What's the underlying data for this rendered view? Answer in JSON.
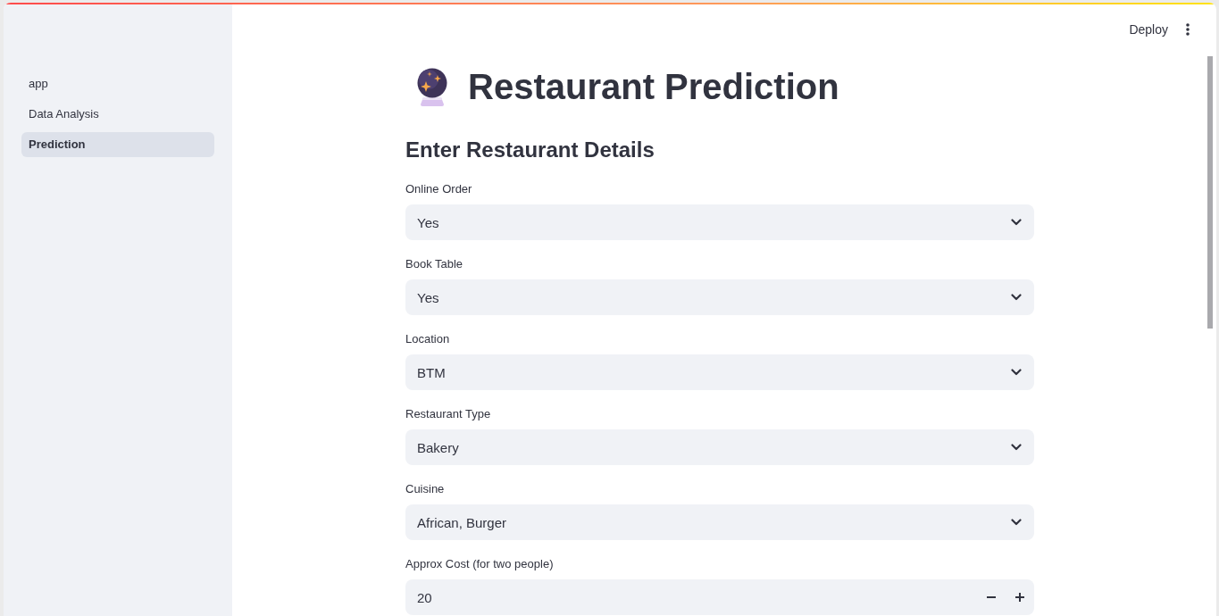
{
  "header": {
    "deploy_label": "Deploy"
  },
  "sidebar": {
    "items": [
      {
        "label": "app",
        "selected": false
      },
      {
        "label": "Data Analysis",
        "selected": false
      },
      {
        "label": "Prediction",
        "selected": true
      }
    ]
  },
  "main": {
    "title": "Restaurant Prediction",
    "subtitle": "Enter Restaurant Details",
    "fields": [
      {
        "kind": "select",
        "label": "Online Order",
        "value": "Yes"
      },
      {
        "kind": "select",
        "label": "Book Table",
        "value": "Yes"
      },
      {
        "kind": "select",
        "label": "Location",
        "value": "BTM"
      },
      {
        "kind": "select",
        "label": "Restaurant Type",
        "value": "Bakery"
      },
      {
        "kind": "select",
        "label": "Cuisine",
        "value": "African, Burger"
      },
      {
        "kind": "number",
        "label": "Approx Cost (for two people)",
        "value": "20"
      }
    ]
  }
}
